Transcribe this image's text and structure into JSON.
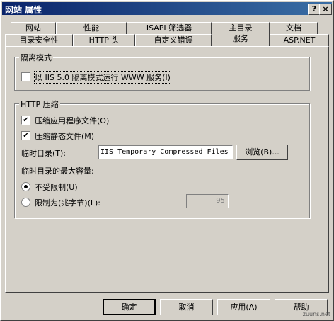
{
  "window": {
    "title": "网站 属性",
    "help_btn": "?",
    "close_btn": "×"
  },
  "tabs_row1": [
    "网站",
    "性能",
    "ISAPI 筛选器",
    "主目录",
    "文档"
  ],
  "tabs_row2": [
    "目录安全性",
    "HTTP 头",
    "自定义错误",
    "服务",
    "ASP.NET"
  ],
  "isolation": {
    "group_label": "隔离模式",
    "checkbox_label": "以 IIS 5.0 隔离模式运行 WWW 服务(I)",
    "checked": false
  },
  "compression": {
    "group_label": "HTTP 压缩",
    "compress_app": {
      "label": "压缩应用程序文件(O)",
      "checked": true
    },
    "compress_static": {
      "label": "压缩静态文件(M)",
      "checked": true
    },
    "temp_dir_label": "临时目录(T):",
    "temp_dir_value": "IIS Temporary Compressed Files",
    "browse_label": "浏览(B)...",
    "max_size_label": "临时目录的最大容量:",
    "unlimited_label": "不受限制(U)",
    "limit_label": "限制为(兆字节)(L):",
    "limit_value": "95",
    "selected": "unlimited"
  },
  "buttons": {
    "ok": "确定",
    "cancel": "取消",
    "apply": "应用(A)",
    "help": "帮助"
  },
  "watermark": "zuuns.net"
}
